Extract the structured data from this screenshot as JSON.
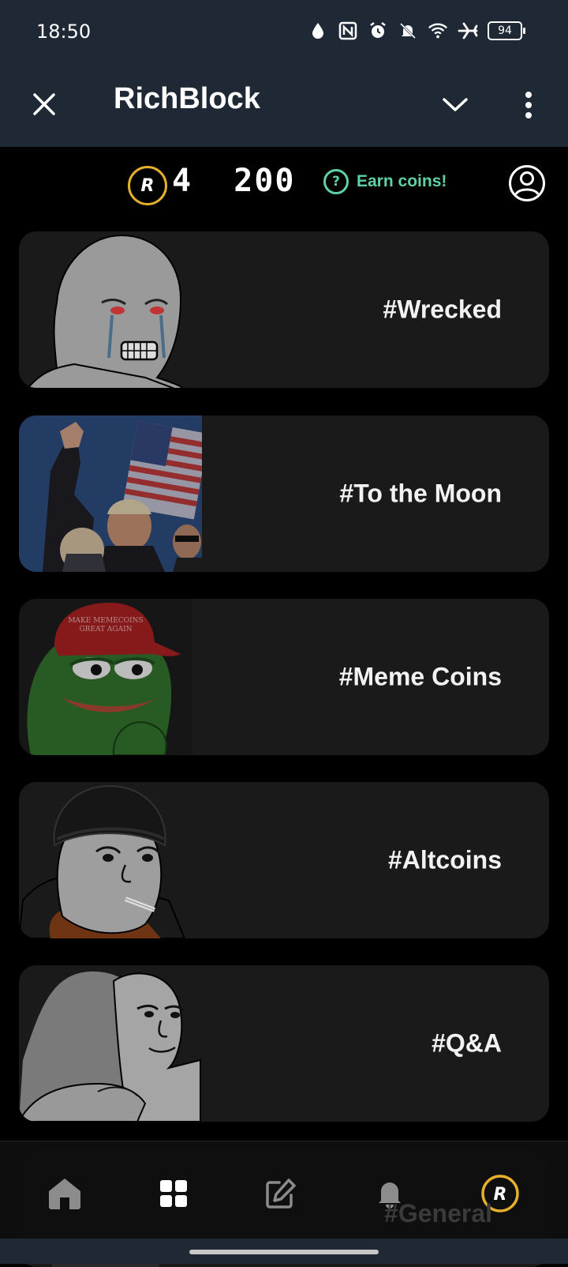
{
  "status_bar": {
    "time": "18:50",
    "battery": "94",
    "icons": [
      "water-drop-icon",
      "nfc-icon",
      "alarm-icon",
      "bell-off-icon",
      "wifi-icon",
      "airplane-icon",
      "battery-icon"
    ]
  },
  "app_bar": {
    "title": "RichBlock",
    "close_icon": "close-icon",
    "chevron_icon": "chevron-down-icon",
    "menu_icon": "more-vertical-icon"
  },
  "coins": {
    "icon_letter": "R",
    "balance": "4  200",
    "earn_label": "Earn coins!",
    "earn_color": "#5fd1a5",
    "coin_color": "#e6b02b"
  },
  "categories": [
    {
      "label": "#Wrecked"
    },
    {
      "label": "#To the Moon"
    },
    {
      "label": "#Meme Coins"
    },
    {
      "label": "#Altcoins"
    },
    {
      "label": "#Q&A"
    },
    {
      "label": "#General"
    }
  ],
  "bottom_nav": {
    "items": [
      "home-icon",
      "grid-icon",
      "edit-icon",
      "bell-icon",
      "coin-icon"
    ],
    "active_color": "#e6b02b"
  }
}
